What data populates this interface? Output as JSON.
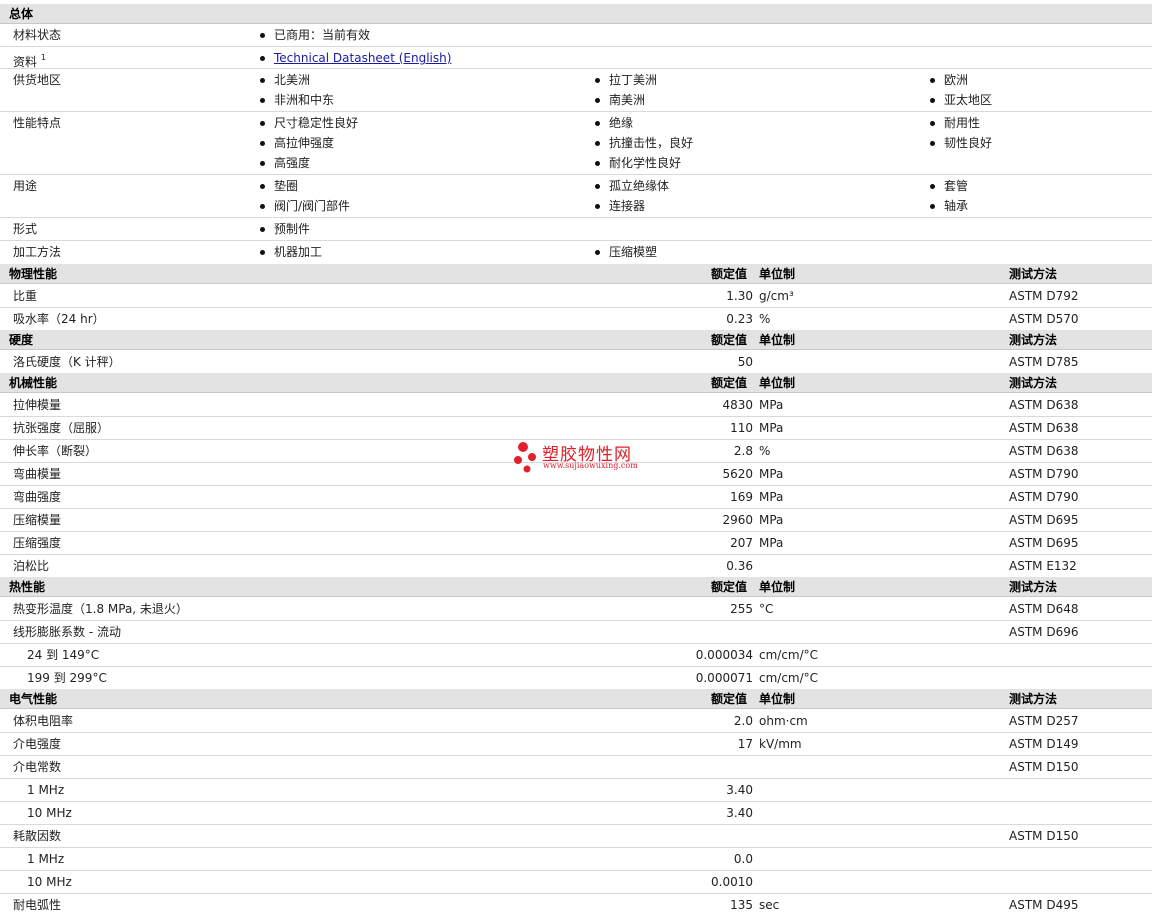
{
  "general": {
    "title": "总体",
    "material_status_label": "材料状态",
    "material_status_value": "已商用：当前有效",
    "documents_label": "资料",
    "documents_sup": "1",
    "documents_link": "Technical Datasheet (English)",
    "availability_label": "供货地区",
    "availability": [
      "北美洲",
      "拉丁美洲",
      "欧洲",
      "非洲和中东",
      "南美洲",
      "亚太地区"
    ],
    "features_label": "性能特点",
    "features": [
      "尺寸稳定性良好",
      "绝缘",
      "耐用性",
      "高拉伸强度",
      "抗撞击性，良好",
      "韧性良好",
      "高强度",
      "耐化学性良好"
    ],
    "uses_label": "用途",
    "uses": [
      "垫圈",
      "孤立绝缘体",
      "套管",
      "阀门/阀门部件",
      "连接器",
      "轴承"
    ],
    "forms_label": "形式",
    "forms_value": "预制件",
    "processing_label": "加工方法",
    "processing": [
      "机器加工",
      "压缩模塑"
    ]
  },
  "columns": {
    "nominal": "额定值",
    "unit": "单位制",
    "method": "测试方法"
  },
  "sections": {
    "physical": {
      "title": "物理性能",
      "rows": [
        {
          "name": "比重",
          "value": "1.30",
          "unit": "g/cm³",
          "method": "ASTM D792"
        },
        {
          "name": "吸水率（24 hr）",
          "value": "0.23",
          "unit": "%",
          "method": "ASTM D570"
        }
      ]
    },
    "hardness": {
      "title": "硬度",
      "rows": [
        {
          "name": "洛氏硬度（K 计秤）",
          "value": "50",
          "unit": "",
          "method": "ASTM D785"
        }
      ]
    },
    "mechanical": {
      "title": "机械性能",
      "rows": [
        {
          "name": "拉伸模量",
          "value": "4830",
          "unit": "MPa",
          "method": "ASTM D638"
        },
        {
          "name": "抗张强度（屈服）",
          "value": "110",
          "unit": "MPa",
          "method": "ASTM D638"
        },
        {
          "name": "伸长率（断裂）",
          "value": "2.8",
          "unit": "%",
          "method": "ASTM D638"
        },
        {
          "name": "弯曲模量",
          "value": "5620",
          "unit": "MPa",
          "method": "ASTM D790"
        },
        {
          "name": "弯曲强度",
          "value": "169",
          "unit": "MPa",
          "method": "ASTM D790"
        },
        {
          "name": "压缩模量",
          "value": "2960",
          "unit": "MPa",
          "method": "ASTM D695"
        },
        {
          "name": "压缩强度",
          "value": "207",
          "unit": "MPa",
          "method": "ASTM D695"
        },
        {
          "name": "泊松比",
          "value": "0.36",
          "unit": "",
          "method": "ASTM E132"
        }
      ]
    },
    "thermal": {
      "title": "热性能",
      "rows": [
        {
          "name": "热变形温度（1.8 MPa, 未退火）",
          "value": "255",
          "unit": "°C",
          "method": "ASTM D648"
        },
        {
          "name": "线形膨胀系数 - 流动",
          "value": "",
          "unit": "",
          "method": "ASTM D696"
        },
        {
          "name": "24 到  149°C",
          "value": "0.000034",
          "unit": "cm/cm/°C",
          "method": ""
        },
        {
          "name": "199 到  299°C",
          "value": "0.000071",
          "unit": "cm/cm/°C",
          "method": ""
        }
      ]
    },
    "electrical": {
      "title": "电气性能",
      "rows": [
        {
          "name": "体积电阻率",
          "value": "2.0",
          "unit": "ohm·cm",
          "method": "ASTM D257"
        },
        {
          "name": "介电强度",
          "value": "17",
          "unit": "kV/mm",
          "method": "ASTM D149"
        },
        {
          "name": "介电常数",
          "value": "",
          "unit": "",
          "method": "ASTM D150"
        },
        {
          "name": "1 MHz",
          "value": "3.40",
          "unit": "",
          "method": ""
        },
        {
          "name": "10 MHz",
          "value": "3.40",
          "unit": "",
          "method": ""
        },
        {
          "name": "耗散因数",
          "value": "",
          "unit": "",
          "method": "ASTM D150"
        },
        {
          "name": "1 MHz",
          "value": "0.0",
          "unit": "",
          "method": ""
        },
        {
          "name": "10 MHz",
          "value": "0.0010",
          "unit": "",
          "method": ""
        },
        {
          "name": "耐电弧性",
          "value": "135",
          "unit": "sec",
          "method": "ASTM D495"
        }
      ]
    }
  },
  "watermark": {
    "text": "塑胶物性网",
    "url": "www.sujiaowuxing.com",
    "color": "#e0202a"
  }
}
